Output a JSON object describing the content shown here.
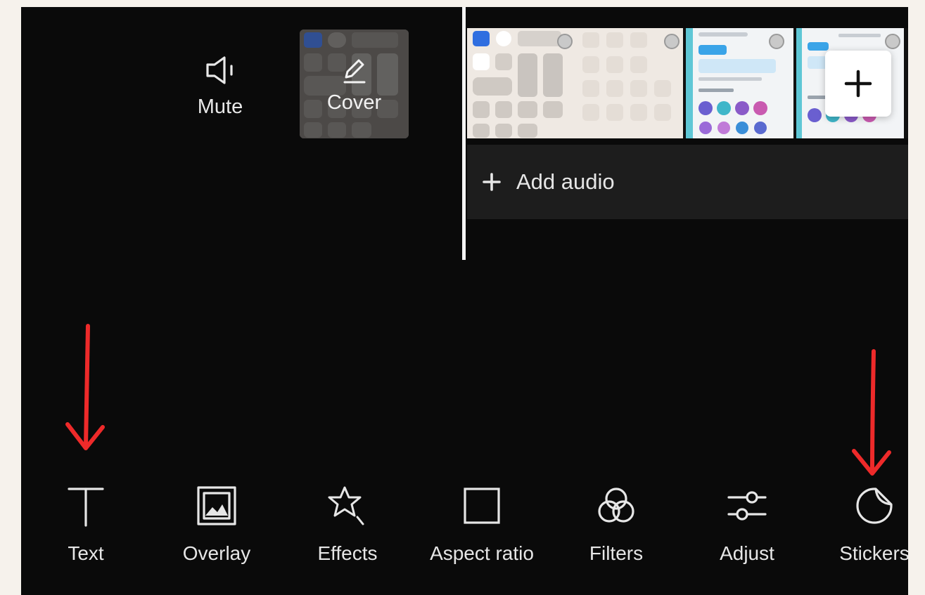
{
  "top_tools": {
    "mute": {
      "label": "Mute",
      "icon": "speaker-icon"
    },
    "cover": {
      "label": "Cover",
      "icon": "pencil-icon"
    }
  },
  "timeline": {
    "add_clip_icon": "plus-icon",
    "add_audio_label": "Add audio",
    "add_audio_icon": "plus-icon"
  },
  "toolbar": {
    "items": [
      {
        "label": "Text",
        "icon": "text-icon"
      },
      {
        "label": "Overlay",
        "icon": "overlay-icon"
      },
      {
        "label": "Effects",
        "icon": "effects-star-icon"
      },
      {
        "label": "Aspect ratio",
        "icon": "aspect-ratio-icon"
      },
      {
        "label": "Filters",
        "icon": "filters-icon"
      },
      {
        "label": "Adjust",
        "icon": "adjust-sliders-icon"
      },
      {
        "label": "Stickers",
        "icon": "sticker-icon"
      }
    ]
  },
  "colors": {
    "background": "#0a0a0a",
    "text": "#e6e6e6",
    "audio_track": "#1d1d1d",
    "annotation_arrow": "#ee2a2a"
  }
}
